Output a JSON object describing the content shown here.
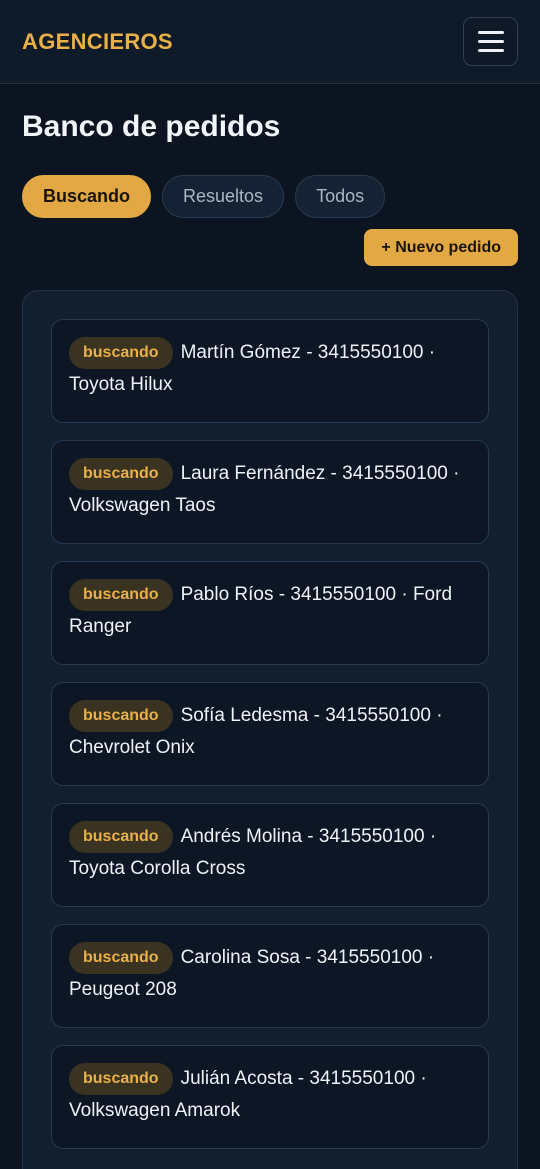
{
  "header": {
    "brand": "AGENCIEROS",
    "menu_icon": "hamburger-menu-icon"
  },
  "page": {
    "title": "Banco de pedidos"
  },
  "tabs": [
    {
      "label": "Buscando",
      "active": true
    },
    {
      "label": "Resueltos",
      "active": false
    },
    {
      "label": "Todos",
      "active": false
    }
  ],
  "actions": {
    "new_order": "+ Nuevo pedido"
  },
  "colors": {
    "accent": "#e2a843",
    "background": "#0b1420"
  },
  "orders": [
    {
      "status": "buscando",
      "text": "Martín Gómez - 3415550100 · Toyota Hilux"
    },
    {
      "status": "buscando",
      "text": "Laura Fernández - 3415550100 · Volkswagen Taos"
    },
    {
      "status": "buscando",
      "text": "Pablo Ríos - 3415550100 · Ford Ranger"
    },
    {
      "status": "buscando",
      "text": "Sofía Ledesma - 3415550100 · Chevrolet Onix"
    },
    {
      "status": "buscando",
      "text": "Andrés Molina - 3415550100 · Toyota Corolla Cross"
    },
    {
      "status": "buscando",
      "text": "Carolina Sosa - 3415550100 · Peugeot 208"
    },
    {
      "status": "buscando",
      "text": "Julián Acosta - 3415550100 · Volkswagen Amarok"
    }
  ]
}
